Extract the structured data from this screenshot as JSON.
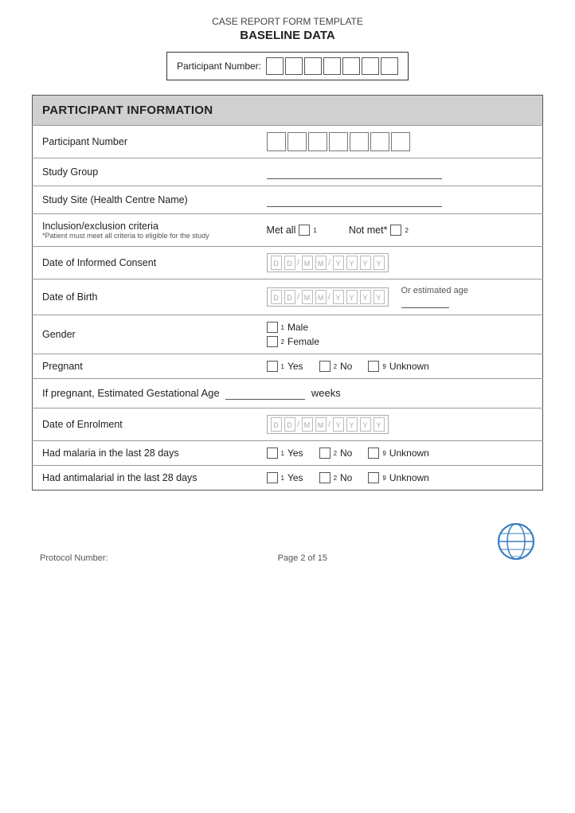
{
  "header": {
    "form_type": "CASE REPORT FORM TEMPLATE",
    "form_title": "BASELINE DATA",
    "participant_number_label": "Participant Number:",
    "pn_cells_count": 7
  },
  "section": {
    "title": "PARTICIPANT INFORMATION"
  },
  "rows": [
    {
      "id": "participant-number",
      "label": "Participant Number",
      "type": "pn_cells",
      "cells": 7
    },
    {
      "id": "study-group",
      "label": "Study Group",
      "type": "underline"
    },
    {
      "id": "study-site",
      "label": "Study Site (Health Centre Name)",
      "type": "underline"
    },
    {
      "id": "inclusion-criteria",
      "label": "Inclusion/exclusion criteria",
      "sublabel": "*Patient must meet all criteria to eligible for the study",
      "type": "inclusion",
      "options": [
        {
          "label": "Met all",
          "sub": "1"
        },
        {
          "label": "Not met*",
          "sub": "2"
        }
      ]
    },
    {
      "id": "date-informed-consent",
      "label": "Date of Informed Consent",
      "type": "date"
    },
    {
      "id": "date-of-birth",
      "label": "Date of Birth",
      "type": "date_with_estimated",
      "estimated_label": "Or estimated age"
    },
    {
      "id": "gender",
      "label": "Gender",
      "type": "gender",
      "options": [
        {
          "label": "Male",
          "sub": "1"
        },
        {
          "label": "Female",
          "sub": "2"
        }
      ]
    },
    {
      "id": "pregnant",
      "label": "Pregnant",
      "type": "yes_no_unknown",
      "options": [
        {
          "label": "Yes",
          "sub": "1"
        },
        {
          "label": "No",
          "sub": "2"
        },
        {
          "label": "Unknown",
          "sub": "9"
        }
      ]
    },
    {
      "id": "gestational-age",
      "label": "If pregnant, Estimated Gestational Age",
      "type": "full_text",
      "suffix": "weeks",
      "blank_width": 100
    },
    {
      "id": "date-enrolment",
      "label": "Date of Enrolment",
      "type": "date"
    },
    {
      "id": "had-malaria",
      "label": "Had malaria in the last 28 days",
      "type": "yes_no_unknown",
      "options": [
        {
          "label": "Yes",
          "sub": "1"
        },
        {
          "label": "No",
          "sub": "2"
        },
        {
          "label": "Unknown",
          "sub": "9"
        }
      ]
    },
    {
      "id": "had-antimalarial",
      "label": "Had antimalarial in the last 28 days",
      "type": "yes_no_unknown",
      "options": [
        {
          "label": "Yes",
          "sub": "1"
        },
        {
          "label": "No",
          "sub": "2"
        },
        {
          "label": "Unknown",
          "sub": "9"
        }
      ]
    }
  ],
  "footer": {
    "protocol_label": "Protocol Number:",
    "page_text": "Page 2 of 15"
  }
}
